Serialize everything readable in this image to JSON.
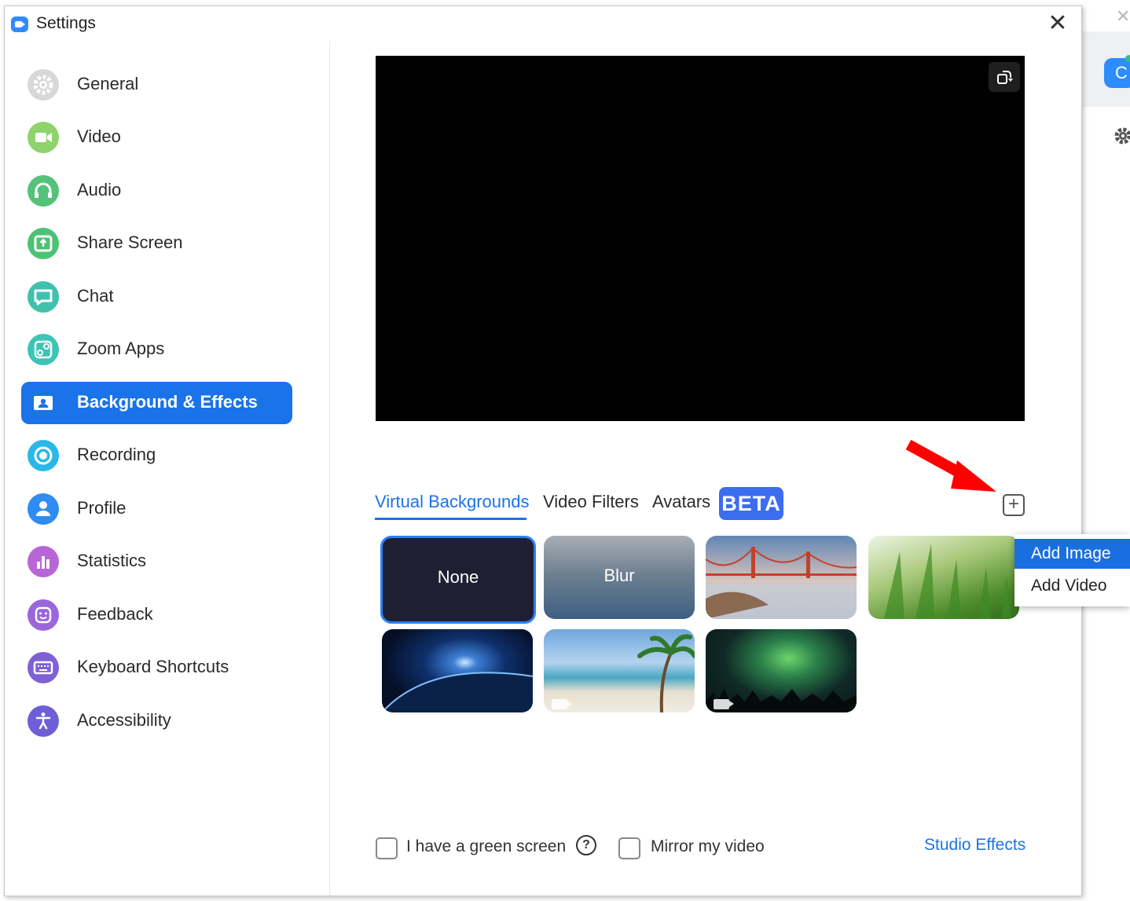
{
  "window": {
    "title": "Settings",
    "close_glyph": "✕"
  },
  "sidebar": {
    "items": [
      {
        "label": "General",
        "icon": "gear-icon",
        "color": "#d0d0d0"
      },
      {
        "label": "Video",
        "icon": "video-camera-icon",
        "color": "#8fd36b"
      },
      {
        "label": "Audio",
        "icon": "headphones-icon",
        "color": "#55c27a"
      },
      {
        "label": "Share Screen",
        "icon": "share-screen-icon",
        "color": "#4cc274"
      },
      {
        "label": "Chat",
        "icon": "chat-bubble-icon",
        "color": "#3fc1ad"
      },
      {
        "label": "Zoom Apps",
        "icon": "apps-icon",
        "color": "#3cc5b5"
      },
      {
        "label": "Background & Effects",
        "icon": "background-portrait-icon",
        "color": "#1a73e8"
      },
      {
        "label": "Recording",
        "icon": "record-icon",
        "color": "#2ab8ea"
      },
      {
        "label": "Profile",
        "icon": "user-icon",
        "color": "#2f8cf0"
      },
      {
        "label": "Statistics",
        "icon": "bar-chart-icon",
        "color": "#b866d6"
      },
      {
        "label": "Feedback",
        "icon": "smile-icon",
        "color": "#9a66dc"
      },
      {
        "label": "Keyboard Shortcuts",
        "icon": "keyboard-icon",
        "color": "#8160d6"
      },
      {
        "label": "Accessibility",
        "icon": "accessibility-icon",
        "color": "#6e5fd6"
      }
    ],
    "active_index": 6
  },
  "main": {
    "tabs": [
      {
        "label": "Virtual Backgrounds",
        "active": true
      },
      {
        "label": "Video Filters",
        "active": false
      },
      {
        "label": "Avatars",
        "active": false
      }
    ],
    "beta_badge": "BETA",
    "add_button_glyph": "+",
    "backgrounds": [
      {
        "label": "None",
        "selected": true
      },
      {
        "label": "Blur"
      },
      {
        "icon": "golden-gate-bridge-image"
      },
      {
        "icon": "grass-image"
      },
      {
        "icon": "earth-from-space-image"
      },
      {
        "icon": "beach-palm-video"
      },
      {
        "icon": "aurora-video"
      }
    ],
    "menu": {
      "add_image": "Add Image",
      "add_video": "Add Video"
    },
    "options": {
      "green_screen": "I have a green screen",
      "help_glyph": "?",
      "mirror": "Mirror my video",
      "studio_effects": "Studio Effects"
    }
  },
  "background_app": {
    "avatar_letter": "C",
    "close_glyph": "✕"
  },
  "colors": {
    "accent": "#1a73e8",
    "arrow": "#ff0000",
    "beta": "#3a6df0"
  }
}
